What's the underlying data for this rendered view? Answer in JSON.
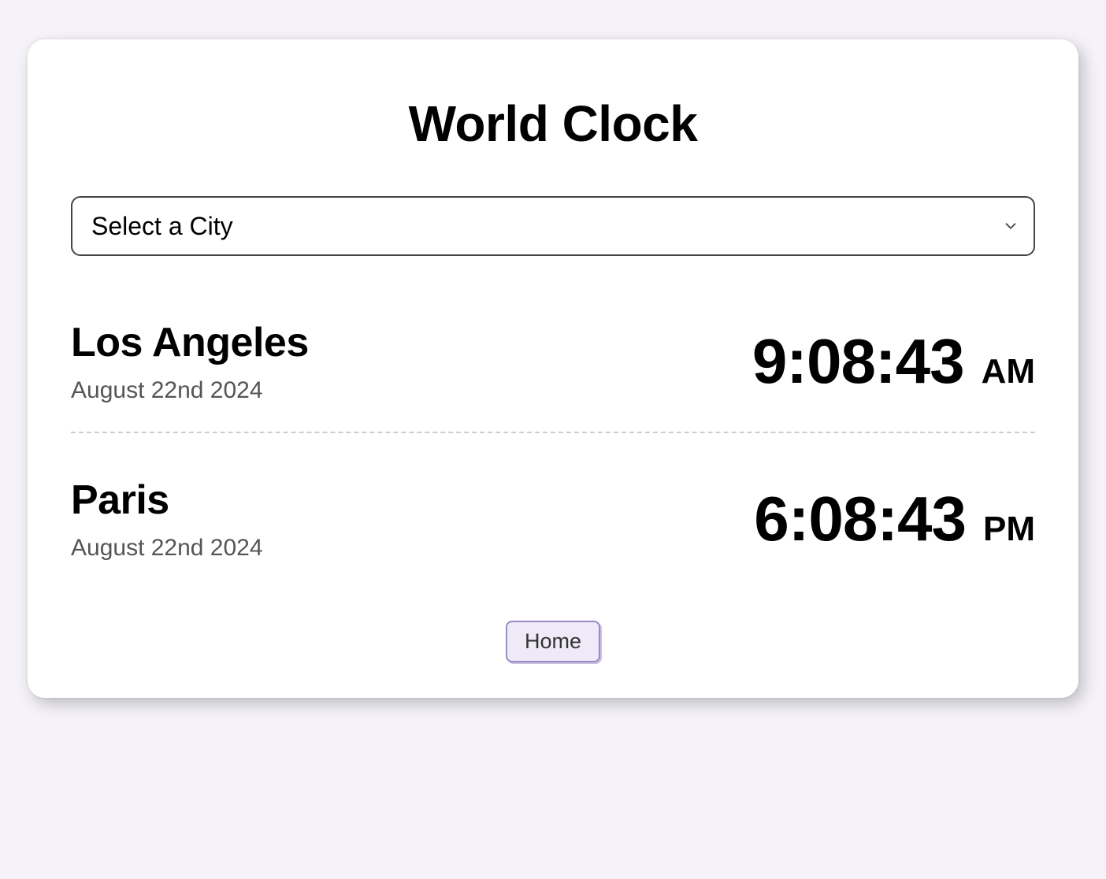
{
  "title": "World Clock",
  "select": {
    "placeholder": "Select a City"
  },
  "clocks": [
    {
      "city": "Los Angeles",
      "date": "August 22nd 2024",
      "time": "9:08:43",
      "period": "AM"
    },
    {
      "city": "Paris",
      "date": "August 22nd 2024",
      "time": "6:08:43",
      "period": "PM"
    }
  ],
  "footer": {
    "home_label": "Home"
  }
}
